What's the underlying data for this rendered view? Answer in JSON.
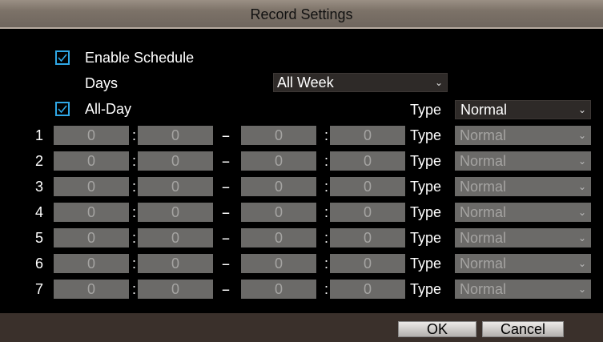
{
  "window": {
    "title": "Record Settings"
  },
  "schedule": {
    "enable_label": "Enable Schedule",
    "enable_checked": true,
    "days_label": "Days",
    "days_value": "All Week",
    "allday_label": "All-Day",
    "allday_checked": true,
    "type_label": "Type",
    "type_value": "Normal"
  },
  "periods": [
    {
      "index": "1",
      "start_hour": "0",
      "start_min": "0",
      "sep": "--",
      "end_hour": "0",
      "end_min": "0",
      "type_label": "Type",
      "type_value": "Normal"
    },
    {
      "index": "2",
      "start_hour": "0",
      "start_min": "0",
      "sep": "--",
      "end_hour": "0",
      "end_min": "0",
      "type_label": "Type",
      "type_value": "Normal"
    },
    {
      "index": "3",
      "start_hour": "0",
      "start_min": "0",
      "sep": "--",
      "end_hour": "0",
      "end_min": "0",
      "type_label": "Type",
      "type_value": "Normal"
    },
    {
      "index": "4",
      "start_hour": "0",
      "start_min": "0",
      "sep": "--",
      "end_hour": "0",
      "end_min": "0",
      "type_label": "Type",
      "type_value": "Normal"
    },
    {
      "index": "5",
      "start_hour": "0",
      "start_min": "0",
      "sep": "--",
      "end_hour": "0",
      "end_min": "0",
      "type_label": "Type",
      "type_value": "Normal"
    },
    {
      "index": "6",
      "start_hour": "0",
      "start_min": "0",
      "sep": "--",
      "end_hour": "0",
      "end_min": "0",
      "type_label": "Type",
      "type_value": "Normal"
    },
    {
      "index": "7",
      "start_hour": "0",
      "start_min": "0",
      "sep": "--",
      "end_hour": "0",
      "end_min": "0",
      "type_label": "Type",
      "type_value": "Normal"
    }
  ],
  "buttons": {
    "ok": "OK",
    "cancel": "Cancel"
  },
  "colors": {
    "accent": "#2fa7e6",
    "footer": "#3a302b",
    "disabled_field": "#6b6a68"
  }
}
